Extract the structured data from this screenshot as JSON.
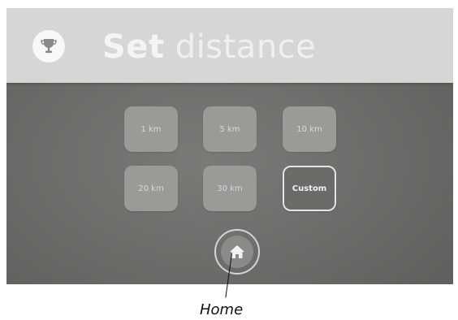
{
  "header": {
    "title_bold": "Set",
    "title_light": " distance",
    "icon": "trophy-icon"
  },
  "distances": [
    {
      "label": "1 km"
    },
    {
      "label": "5 km"
    },
    {
      "label": "10 km"
    },
    {
      "label": "20 km"
    },
    {
      "label": "30 km"
    },
    {
      "label": "Custom"
    }
  ],
  "home": {
    "icon": "home-icon"
  },
  "annotation": {
    "label": "Home"
  },
  "colors": {
    "header_bg": "#d6d6d4",
    "screen_bg": "#6d6d6a",
    "button_bg": "#9a9a97",
    "custom_border": "#e4e4e2"
  }
}
